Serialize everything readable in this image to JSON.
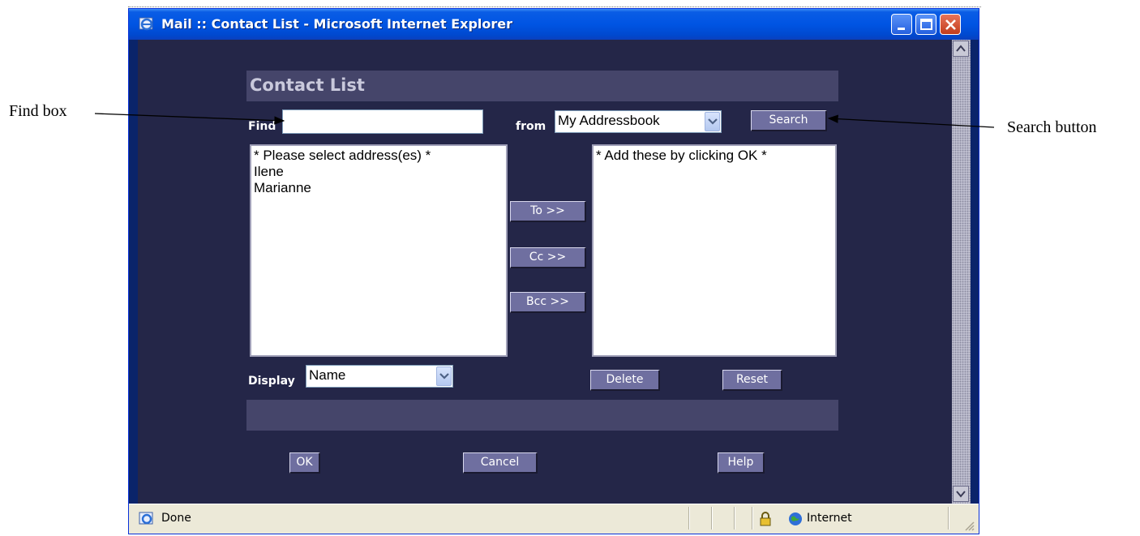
{
  "annotations": {
    "find_box": "Find box",
    "search_button": "Search button"
  },
  "window": {
    "title": "Mail :: Contact List - Microsoft Internet Explorer",
    "icon": "ie-icon"
  },
  "page": {
    "header": "Contact List",
    "find_label": "Find",
    "find_value": "",
    "from_label": "from",
    "from_selected": "My Addressbook",
    "search_label": "Search",
    "source_list": [
      "* Please select address(es) *",
      "Ilene",
      "Marianne"
    ],
    "to_label": "To >>",
    "cc_label": "Cc >>",
    "bcc_label": "Bcc >>",
    "target_list": [
      "* Add these by clicking OK *"
    ],
    "display_label": "Display",
    "display_selected": "Name",
    "delete_label": "Delete",
    "reset_label": "Reset",
    "ok_label": "OK",
    "cancel_label": "Cancel",
    "help_label": "Help"
  },
  "status": {
    "text": "Done",
    "zone": "Internet"
  },
  "colors": {
    "page_bg": "#242648",
    "band": "#45456a",
    "button": "#6f6fa0",
    "titlebar": "#0054e3"
  }
}
